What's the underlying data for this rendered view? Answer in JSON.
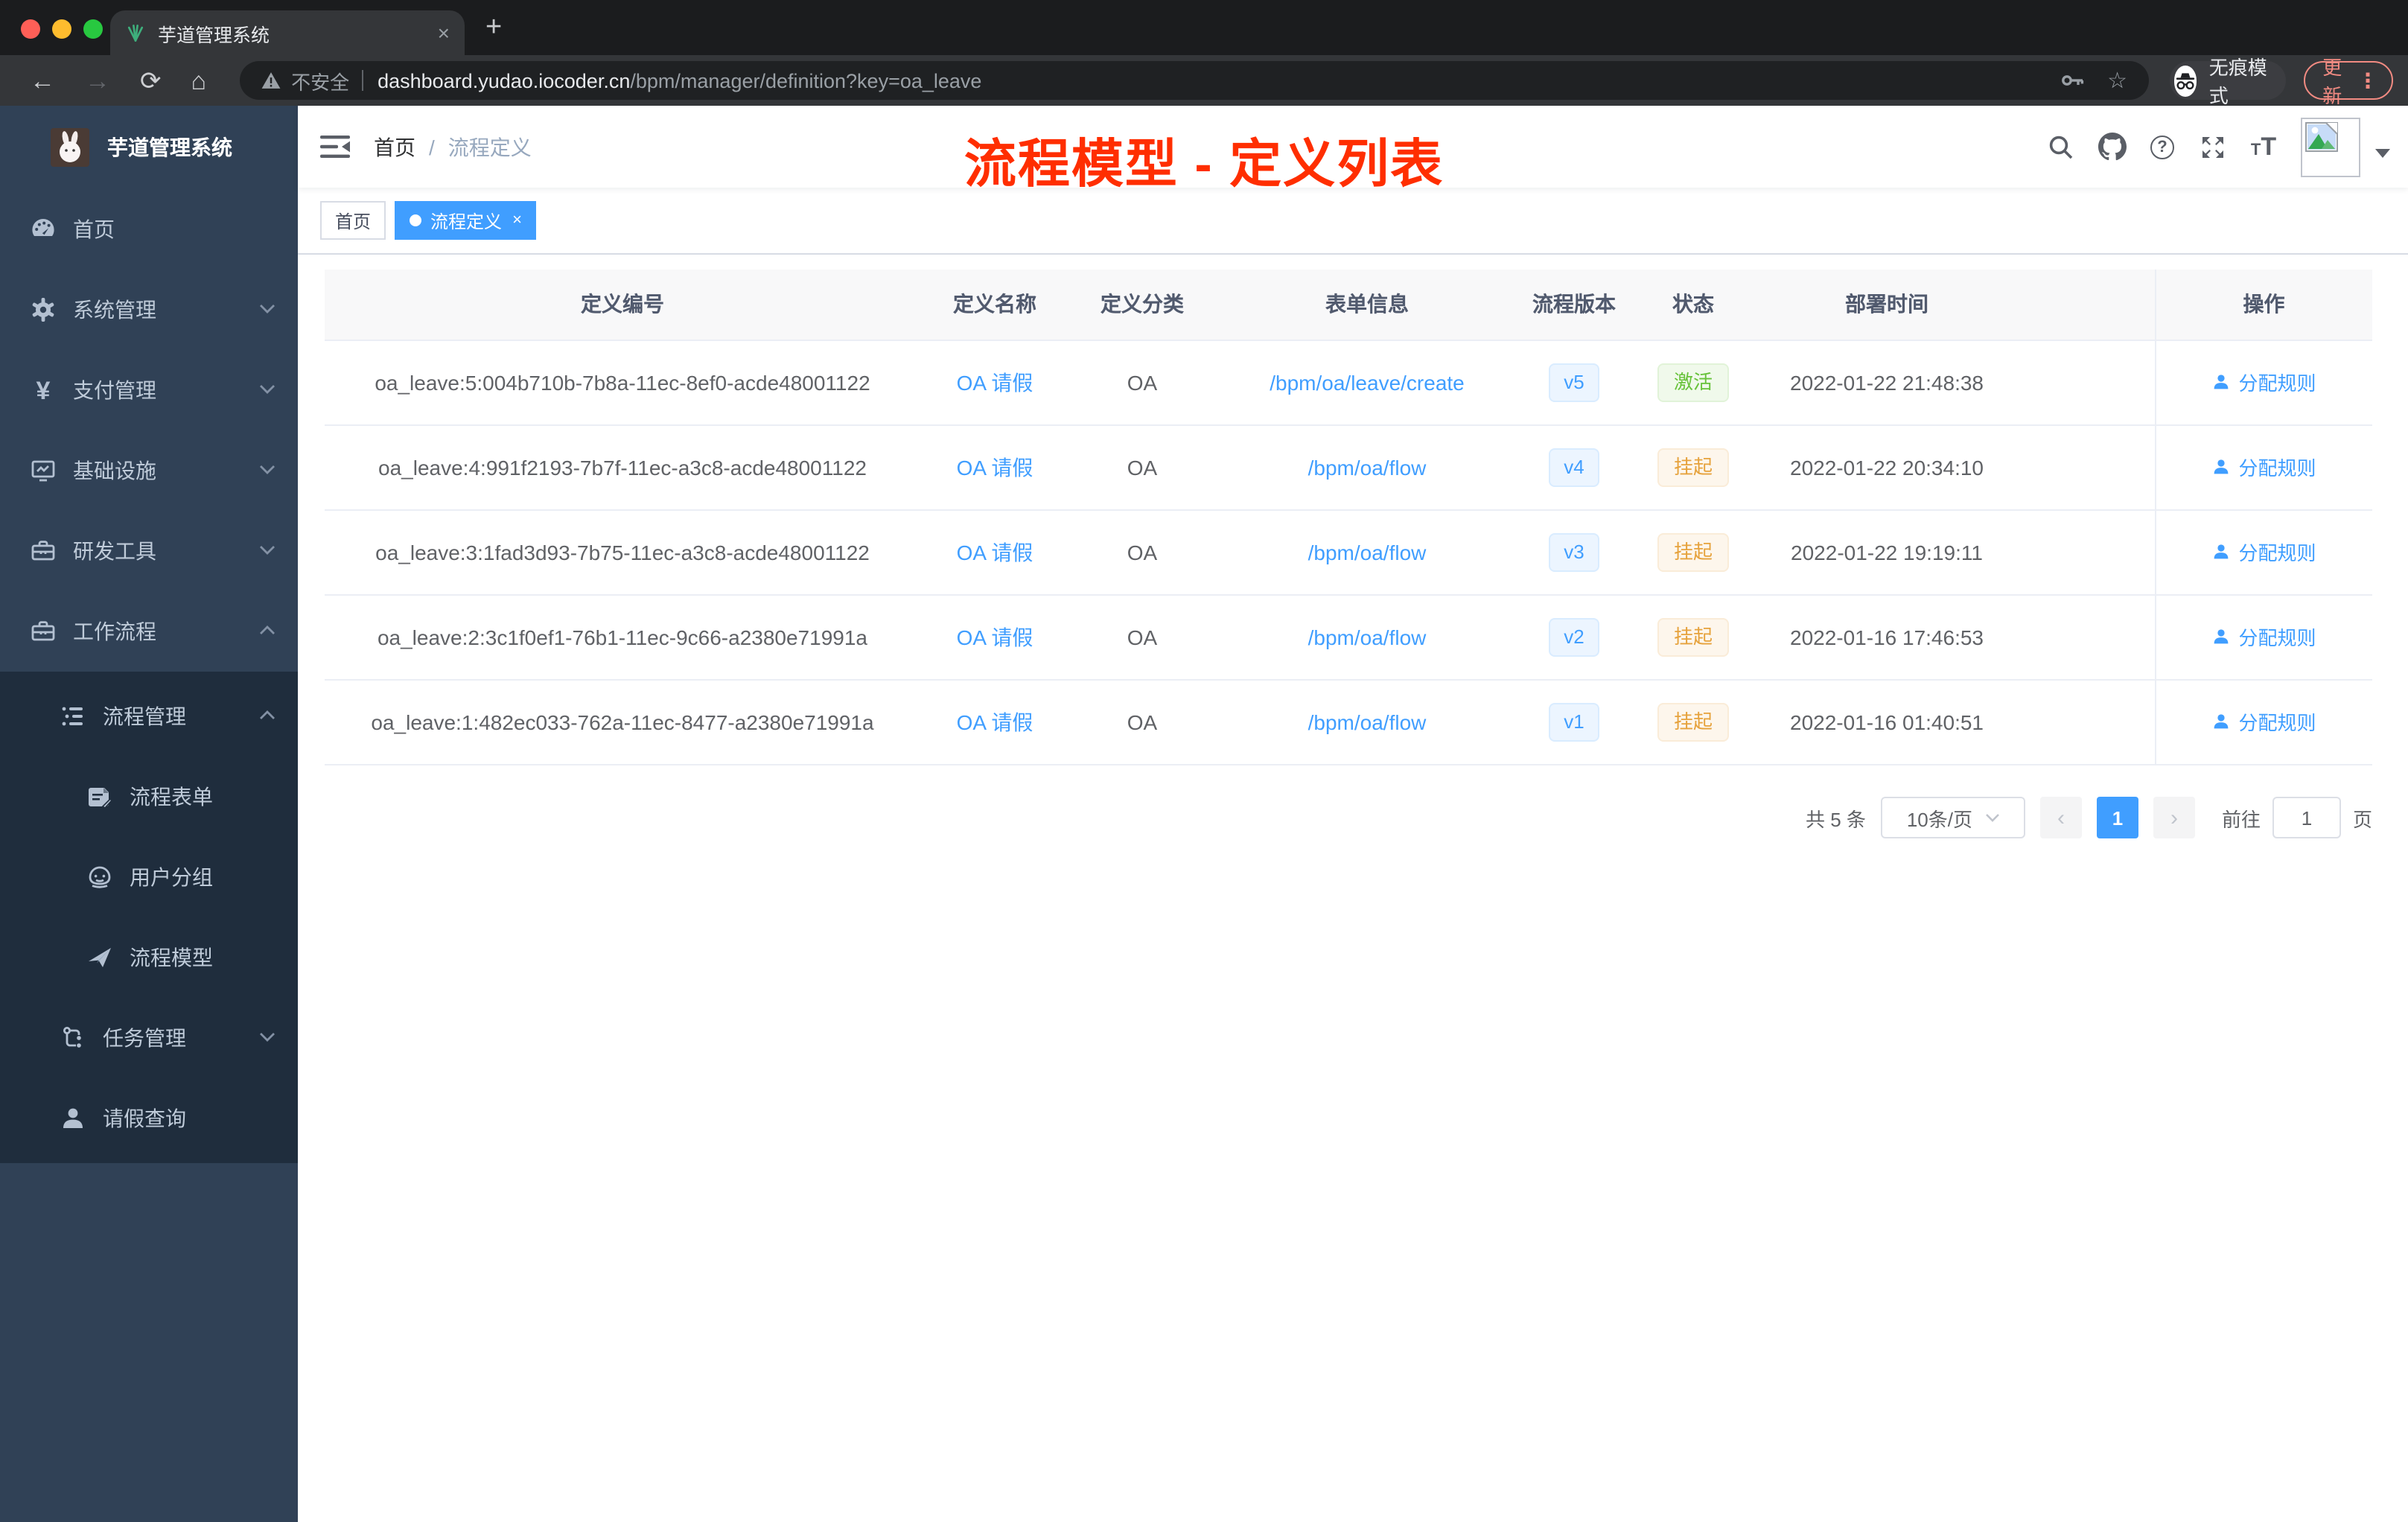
{
  "browser": {
    "traffic_light_colors": [
      "#ff5f57",
      "#febc2e",
      "#28c840"
    ],
    "tab": {
      "title": "芋道管理系统"
    },
    "toolbar": {
      "security_label": "不安全",
      "url_domain": "dashboard.yudao.iocoder.cn",
      "url_path": "/bpm/manager/definition?key=oa_leave",
      "incognito_label": "无痕模式",
      "update_label": "更新"
    },
    "icons": {
      "back": "←",
      "forward": "→",
      "reload": "⟳",
      "home": "⌂",
      "star": "☆",
      "tab_close": "×",
      "new_tab": "+",
      "menu_dots": "⋮",
      "prev": "‹",
      "next": "›"
    }
  },
  "sidebar": {
    "logo_title": "芋道管理系统",
    "menu": [
      {
        "label": "首页"
      },
      {
        "label": "系统管理"
      },
      {
        "label": "支付管理"
      },
      {
        "label": "基础设施"
      },
      {
        "label": "研发工具"
      },
      {
        "label": "工作流程"
      }
    ],
    "submenu": [
      {
        "label": "流程管理"
      },
      {
        "label": "流程表单"
      },
      {
        "label": "用户分组"
      },
      {
        "label": "流程模型"
      },
      {
        "label": "任务管理"
      },
      {
        "label": "请假查询"
      }
    ]
  },
  "header": {
    "breadcrumb_home": "首页",
    "breadcrumb_sep": "/",
    "breadcrumb_current": "流程定义",
    "annotation": "流程模型 - 定义列表",
    "annotation_color": "#ff2e00"
  },
  "tags": [
    {
      "label": "首页"
    },
    {
      "label": "流程定义"
    }
  ],
  "table": {
    "columns": [
      "定义编号",
      "定义名称",
      "定义分类",
      "表单信息",
      "流程版本",
      "状态",
      "部署时间",
      "操作"
    ],
    "action_label": "分配规则",
    "rows": [
      {
        "id": "oa_leave:5:004b710b-7b8a-11ec-8ef0-acde48001122",
        "name": "OA 请假",
        "category": "OA",
        "form": "/bpm/oa/leave/create",
        "version": "v5",
        "status": "激活",
        "status_type": "success",
        "time": "2022-01-22 21:48:38"
      },
      {
        "id": "oa_leave:4:991f2193-7b7f-11ec-a3c8-acde48001122",
        "name": "OA 请假",
        "category": "OA",
        "form": "/bpm/oa/flow",
        "version": "v4",
        "status": "挂起",
        "status_type": "warning",
        "time": "2022-01-22 20:34:10"
      },
      {
        "id": "oa_leave:3:1fad3d93-7b75-11ec-a3c8-acde48001122",
        "name": "OA 请假",
        "category": "OA",
        "form": "/bpm/oa/flow",
        "version": "v3",
        "status": "挂起",
        "status_type": "warning",
        "time": "2022-01-22 19:19:11"
      },
      {
        "id": "oa_leave:2:3c1f0ef1-76b1-11ec-9c66-a2380e71991a",
        "name": "OA 请假",
        "category": "OA",
        "form": "/bpm/oa/flow",
        "version": "v2",
        "status": "挂起",
        "status_type": "warning",
        "time": "2022-01-16 17:46:53"
      },
      {
        "id": "oa_leave:1:482ec033-762a-11ec-8477-a2380e71991a",
        "name": "OA 请假",
        "category": "OA",
        "form": "/bpm/oa/flow",
        "version": "v1",
        "status": "挂起",
        "status_type": "warning",
        "time": "2022-01-16 01:40:51"
      }
    ]
  },
  "pagination": {
    "total": "共 5 条",
    "page_size": "10条/页",
    "page": "1",
    "goto": "前往",
    "goto_value": "1",
    "unit": "页"
  }
}
